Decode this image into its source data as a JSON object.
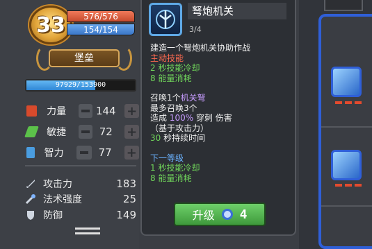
{
  "player": {
    "level": "33",
    "hp": "576/576",
    "mp": "154/154",
    "title_button": "堡垒",
    "xp": "97929/153900",
    "xp_fraction": 0.636
  },
  "stats": [
    {
      "name": "力量",
      "value": "144",
      "icon": "fist-icon",
      "color": "#d84a2c"
    },
    {
      "name": "敏捷",
      "value": "72",
      "icon": "feather-icon",
      "color": "#5cc24a"
    },
    {
      "name": "智力",
      "value": "77",
      "icon": "book-icon",
      "color": "#4a9de0"
    }
  ],
  "combat": [
    {
      "name": "攻击力",
      "value": "183",
      "icon": "sword-icon"
    },
    {
      "name": "法术强度",
      "value": "25",
      "icon": "wand-icon"
    },
    {
      "name": "防御",
      "value": "149",
      "icon": "shield-icon"
    }
  ],
  "tooltip": {
    "title": "弩炮机关",
    "level": "3/4",
    "desc": "建造一个弩炮机关协助作战",
    "type": "主动技能",
    "cooldown_line": "2 秒技能冷却",
    "energy_line": "8 能量消耗",
    "summon_prefix": "召唤1个",
    "summon_target": "机关弩",
    "max_summon": "最多召唤3个",
    "damage_prefix": "造成",
    "damage_pct": "100%",
    "damage_suffix": "穿刺 伤害",
    "based_on": "（基于攻击力）",
    "duration_num": "30",
    "duration_text": "秒持续时间",
    "next_level_label": "下一等级",
    "next_cooldown": "1 秒技能冷却",
    "next_energy": "8 能量消耗",
    "upgrade_label": "升级",
    "upgrade_cost": "4"
  },
  "colors": {
    "hp": "#d9593a",
    "mp": "#4b8ad8",
    "upgrade": "#55b552",
    "frame_blue": "#2f5fd8"
  }
}
